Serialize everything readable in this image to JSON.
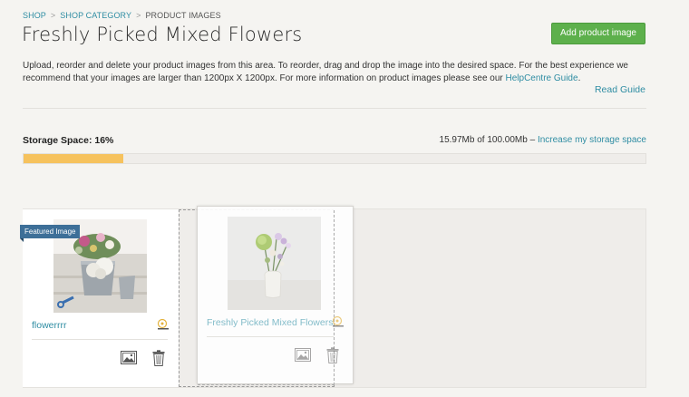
{
  "breadcrumb": {
    "items": [
      {
        "label": "SHOP"
      },
      {
        "label": "SHOP CATEGORY"
      },
      {
        "label": "PRODUCT IMAGES"
      }
    ],
    "separator": ">"
  },
  "page": {
    "title": "Freshly Picked Mixed Flowers",
    "add_button_label": "Add product image"
  },
  "intro": {
    "text": "Upload, reorder and delete your product images from this area. To reorder, drag and drop the image into the desired space. For the best experience we recommend that your images are larger than 1200px X 1200px. For more information on product images please see our ",
    "link_label": "HelpCentre Guide",
    "text_end": ".",
    "read_guide_label": "Read Guide"
  },
  "storage": {
    "label": "Storage Space: 16%",
    "percent": 16,
    "usage_text": "15.97Mb of 100.00Mb – ",
    "increase_link": "Increase my storage space",
    "bar_color": "#f6c25d"
  },
  "gallery": {
    "featured_badge": "Featured Image",
    "cards": [
      {
        "name": "flowerrrr",
        "thumb": "flowers-in-tin-bucket-photo",
        "featured": true
      },
      {
        "name": "Freshly Picked Mixed Flowers",
        "thumb": "flowers-in-white-vase-photo",
        "featured": false,
        "dragging": true
      }
    ]
  },
  "colors": {
    "accent_link": "#2f8da3",
    "primary_button": "#5db04c",
    "badge": "#3d6f98",
    "background": "#f5f4f1"
  }
}
